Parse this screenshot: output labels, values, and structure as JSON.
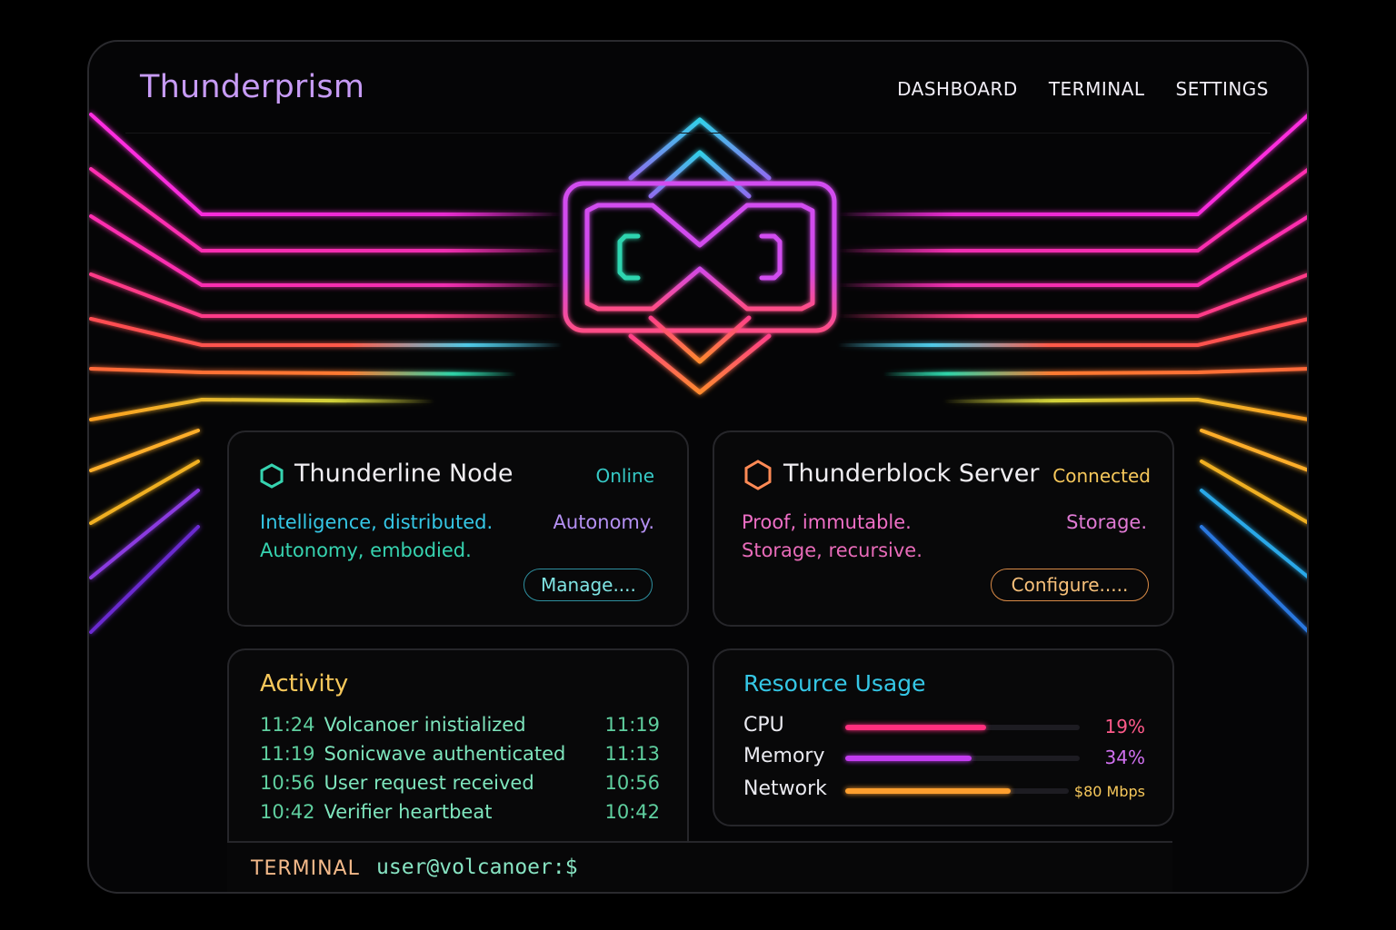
{
  "app": {
    "title": "Thunderprism"
  },
  "nav": {
    "items": [
      "DASHBOARD",
      "TERMINAL",
      "SETTINGS"
    ]
  },
  "node_card": {
    "title": "Thunderline Node",
    "status": "Online",
    "lines": [
      "Intelligence, distributed.",
      "Autonomy, embodied."
    ],
    "side_text": "Autonomy.",
    "button": "Manage...."
  },
  "server_card": {
    "title": "Thunderblock Server",
    "status": "Connected",
    "lines": [
      "Proof, immutable.",
      "Storage, recursive."
    ],
    "side_text": "Storage.",
    "button": "Configure....."
  },
  "activity": {
    "title": "Activity",
    "rows": [
      {
        "time": "11:24",
        "text": "Volcanoer inistialized",
        "right": "11:19"
      },
      {
        "time": "11:19",
        "text": "Sonicwave authenticated",
        "right": "11:13"
      },
      {
        "time": "10:56",
        "text": "User request received",
        "right": "10:56"
      },
      {
        "time": "10:42",
        "text": "Verifier heartbeat",
        "right": "10:42"
      }
    ]
  },
  "resources": {
    "title": "Resource Usage",
    "items": [
      {
        "label": "CPU",
        "value": "19%",
        "fill": 0.6,
        "color": "#ff2f7e"
      },
      {
        "label": "Memory",
        "value": "34%",
        "fill": 0.54,
        "color": "#c23cf0"
      },
      {
        "label": "Network",
        "value": "$80 Mbps",
        "fill": 0.74,
        "color": "#ff9f2e"
      }
    ]
  },
  "terminal": {
    "label": "TERMINAL",
    "prompt": "user@volcanoer:$"
  },
  "colors": {
    "brand": "#c79bf5",
    "teal": "#36d3b0",
    "orange": "#ff8a55",
    "yellow": "#f7c85b",
    "pink": "#ef6fc6",
    "cyan": "#35c7e6"
  },
  "icons": {
    "node": "hexagon-icon",
    "server": "hexagon-icon"
  }
}
